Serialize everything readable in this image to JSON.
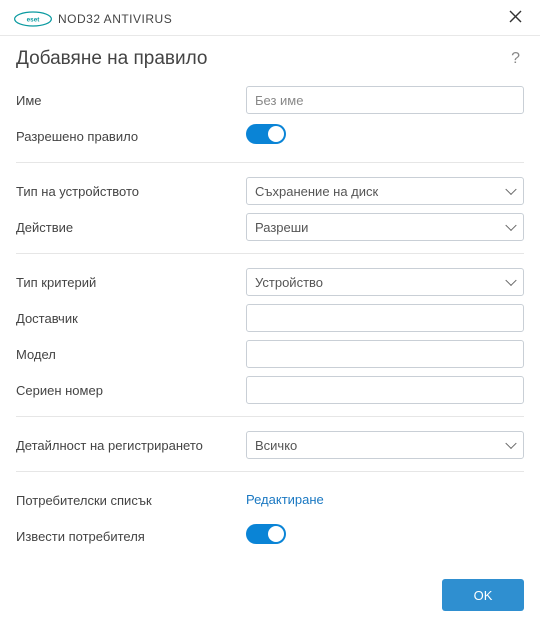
{
  "titlebar": {
    "brand_text": "NOD32 ANTIVIRUS"
  },
  "header": {
    "title": "Добавяне на правило"
  },
  "form": {
    "name": {
      "label": "Име",
      "placeholder": "Без име",
      "value": ""
    },
    "enabled": {
      "label": "Разрешено правило",
      "on": true
    },
    "device_type": {
      "label": "Тип на устройството",
      "value": "Съхранение на диск"
    },
    "action": {
      "label": "Действие",
      "value": "Разреши"
    },
    "criteria_type": {
      "label": "Тип критерий",
      "value": "Устройство"
    },
    "vendor": {
      "label": "Доставчик",
      "value": ""
    },
    "model": {
      "label": "Модел",
      "value": ""
    },
    "serial": {
      "label": "Сериен номер",
      "value": ""
    },
    "logging": {
      "label": "Детайлност на регистрирането",
      "value": "Всичко"
    },
    "user_list": {
      "label": "Потребителски списък",
      "link": "Редактиране"
    },
    "notify": {
      "label": "Извести потребителя",
      "on": true
    }
  },
  "footer": {
    "ok": "OK"
  }
}
